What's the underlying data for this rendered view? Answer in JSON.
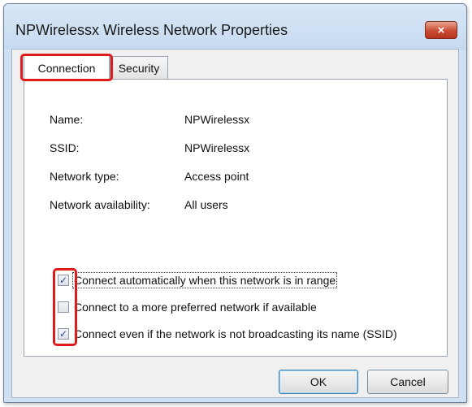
{
  "window": {
    "title": "NPWirelessx Wireless Network Properties",
    "close_glyph": "×"
  },
  "tabs": [
    {
      "label": "Connection",
      "selected": true
    },
    {
      "label": "Security",
      "selected": false
    }
  ],
  "info": [
    {
      "label": "Name:",
      "value": "NPWirelessx"
    },
    {
      "label": "SSID:",
      "value": "NPWirelessx"
    },
    {
      "label": "Network type:",
      "value": "Access point"
    },
    {
      "label": "Network availability:",
      "value": "All users"
    }
  ],
  "options": [
    {
      "label": "Connect automatically when this network is in range",
      "checked": true
    },
    {
      "label": "Connect to a more preferred network if available",
      "checked": false
    },
    {
      "label": "Connect even if the network is not broadcasting its name (SSID)",
      "checked": true
    }
  ],
  "buttons": {
    "ok": "OK",
    "cancel": "Cancel"
  },
  "colors": {
    "highlight": "#e01b1b",
    "close_button": "#c84c33",
    "titlebar": "#cfe0f3"
  },
  "icons": {
    "close": "close-icon",
    "check": "checkmark-icon"
  }
}
